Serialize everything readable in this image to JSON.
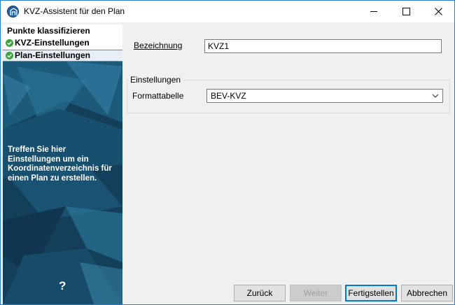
{
  "window": {
    "title": "KVZ-Assistent für den Plan",
    "controls": [
      "minimize",
      "maximize",
      "close"
    ]
  },
  "steps": [
    {
      "label": "Punkte klassifizieren",
      "checked": false,
      "selected": false
    },
    {
      "label": "KVZ-Einstellungen",
      "checked": true,
      "selected": false
    },
    {
      "label": "Plan-Einstellungen",
      "checked": true,
      "selected": true
    }
  ],
  "help": {
    "text": "Treffen Sie hier Einstellungen um ein Koordinatenverzeichnis für einen Plan zu erstellen.",
    "icon_label": "?"
  },
  "form": {
    "bezeichnung_label": "Bezeichnung",
    "bezeichnung_value": "KVZ1",
    "group_title": "Einstellungen",
    "formattabelle_label": "Formattabelle",
    "formattabelle_value": "BEV-KVZ"
  },
  "buttons": {
    "back": "Zurück",
    "next": "Weiter",
    "finish": "Fertigstellen",
    "cancel": "Abbrechen"
  },
  "colors": {
    "accent": "#0078d7",
    "panel_dark": "#123e58",
    "check_green": "#3aa53a"
  }
}
